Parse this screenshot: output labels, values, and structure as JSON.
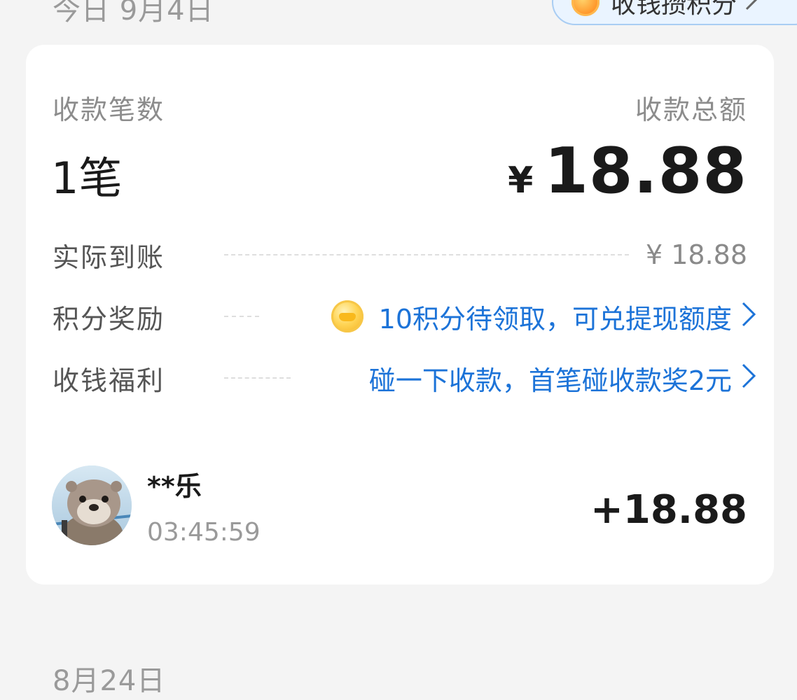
{
  "header": {
    "date_label": "今日 9月4日",
    "points_button_label": "收钱攒积分"
  },
  "summary": {
    "count_label": "收款笔数",
    "count_value": "1笔",
    "total_label": "收款总额",
    "total_currency": "¥",
    "total_value": "18.88"
  },
  "details": {
    "received_label": "实际到账",
    "received_value": "¥ 18.88",
    "points_label": "积分奖励",
    "points_value": "10积分待领取，可兑提现额度",
    "welfare_label": "收钱福利",
    "welfare_value": "碰一下收款，首笔碰收款奖2元"
  },
  "transaction": {
    "payer": "**乐",
    "time": "03:45:59",
    "amount": "+18.88"
  },
  "next_section": {
    "date_label": "8月24日"
  },
  "icons": {
    "points_pill": "coin-icon",
    "points_row": "coin-icon",
    "chevrons": "chevron-right-icon"
  },
  "colors": {
    "accent_blue": "#1c73d8",
    "background": "#f4f4f4",
    "card": "#ffffff"
  }
}
